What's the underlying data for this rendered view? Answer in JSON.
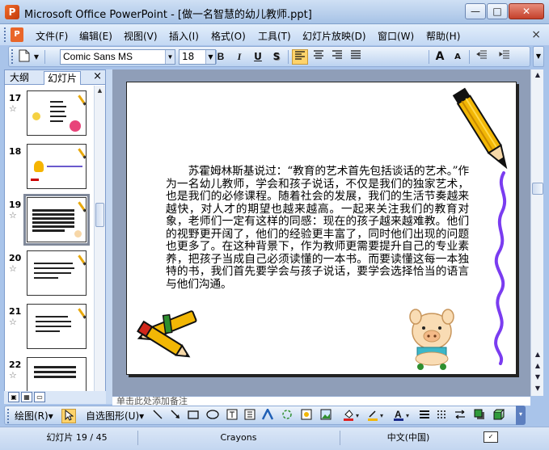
{
  "window": {
    "title": "Microsoft Office PowerPoint - [做一名智慧的幼儿教师.ppt]",
    "app_icon_letter": "P",
    "min_glyph": "—",
    "max_glyph": "□",
    "close_glyph": "✕"
  },
  "menu": {
    "items": [
      "文件(F)",
      "编辑(E)",
      "视图(V)",
      "插入(I)",
      "格式(O)",
      "工具(T)",
      "幻灯片放映(D)",
      "窗口(W)",
      "帮助(H)"
    ],
    "close_glyph": "×"
  },
  "toolbar": {
    "font": "Comic Sans MS",
    "size": "18",
    "bold": "B",
    "italic": "I",
    "underline": "U",
    "shadow": "S",
    "align_left": "≡",
    "align_center": "≡",
    "align_right": "≡",
    "grow_font": "A",
    "shrink_font": "A",
    "dropdown": "▼"
  },
  "left_panel": {
    "tabs": [
      "大纲",
      "幻灯片"
    ],
    "active_tab": "幻灯片",
    "close_glyph": "×",
    "slides": [
      {
        "number": "17",
        "selected": false
      },
      {
        "number": "18",
        "selected": false
      },
      {
        "number": "19",
        "selected": true
      },
      {
        "number": "20",
        "selected": false
      },
      {
        "number": "21",
        "selected": false
      },
      {
        "number": "22",
        "selected": false
      }
    ],
    "star_glyph": "☆"
  },
  "slide": {
    "body": "苏霍姆林斯基说过：“教育的艺术首先包括谈话的艺术。”作为一名幼儿教师，学会和孩子说话，不仅是我们的独家艺术，也是我们的必修课程。随着社会的发展，我们的生活节奏越来越快，对人才的期望也越来越高。一起来关注我们的教育对象，老师们一定有这样的同感：现在的孩子越来越难教。他们的视野更开阔了，他们的经验更丰富了，同时他们出现的问题也更多了。在这种背景下，作为教师更需要提升自己的专业素养，把孩子当成自己必须读懂的一本书。而要读懂这每一本独特的书，我们首先要学会与孩子说话，要学会选择恰当的语言与他们沟通。"
  },
  "notes": {
    "text": "单击此处添加备注"
  },
  "draw_toolbar": {
    "draw_label": "绘图(R)",
    "autoshape_label": "自选图形(U)",
    "dropdown": "▾"
  },
  "status": {
    "slide_info": "幻灯片 19 / 45",
    "theme": "Crayons",
    "language": "中文(中国)"
  },
  "colors": {
    "title_bar": "#a7c3e6",
    "slide_area_bg": "#8f9eb8",
    "pencil_yellow": "#f2b705",
    "squiggle_purple": "#7a3cf0"
  }
}
